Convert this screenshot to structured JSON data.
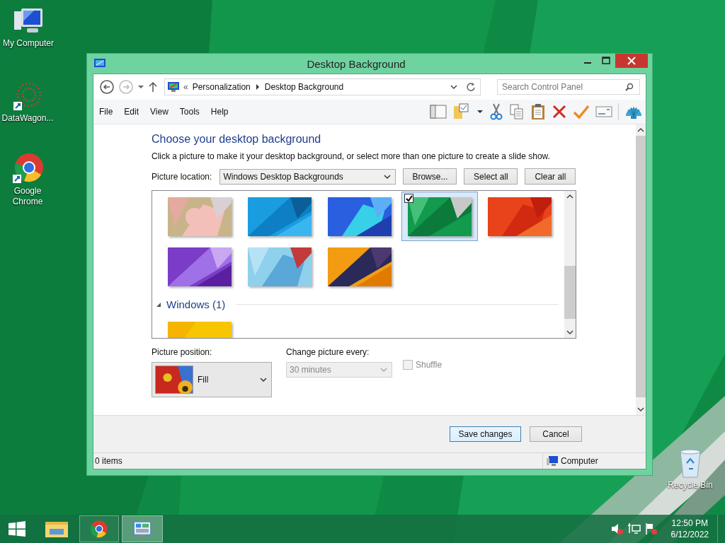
{
  "desktop_icons": [
    {
      "label": "My Computer",
      "kind": "computer"
    },
    {
      "label": "DataWagon...",
      "kind": "app"
    },
    {
      "label": "Google Chrome",
      "kind": "chrome"
    },
    {
      "label": "Recycle Bin",
      "kind": "bin"
    }
  ],
  "window": {
    "title": "Desktop Background"
  },
  "address": {
    "overflow": "«",
    "crumbs": [
      "Personalization",
      "Desktop Background"
    ]
  },
  "search": {
    "placeholder": "Search Control Panel"
  },
  "menu": [
    "File",
    "Edit",
    "View",
    "Tools",
    "Help"
  ],
  "heading": "Choose your desktop background",
  "description": "Click a picture to make it your desktop background, or select more than one picture to create a slide show.",
  "picture_location": {
    "label": "Picture location:",
    "value": "Windows Desktop Backgrounds"
  },
  "location_buttons": [
    "Browse...",
    "Select all",
    "Clear all"
  ],
  "thumbnails": [
    {
      "selected": false
    },
    {
      "selected": false
    },
    {
      "selected": false
    },
    {
      "selected": true
    },
    {
      "selected": false
    },
    {
      "selected": false
    },
    {
      "selected": false
    },
    {
      "selected": false
    }
  ],
  "group": {
    "label": "Windows (1)",
    "expanded": true,
    "thumbnails": [
      {
        "selected": false
      }
    ]
  },
  "picture_position": {
    "label": "Picture position:",
    "value": "Fill"
  },
  "change_picture": {
    "label": "Change picture every:",
    "value": "30 minutes",
    "disabled": true
  },
  "shuffle": {
    "label": "Shuffle",
    "checked": false,
    "disabled": true
  },
  "actions": [
    {
      "label": "Save changes",
      "default": true
    },
    {
      "label": "Cancel",
      "default": false
    }
  ],
  "status_bar": {
    "items": "0 items",
    "zone": "Computer"
  },
  "taskbar": {
    "time": "12:50 PM",
    "date": "6/12/2022"
  }
}
